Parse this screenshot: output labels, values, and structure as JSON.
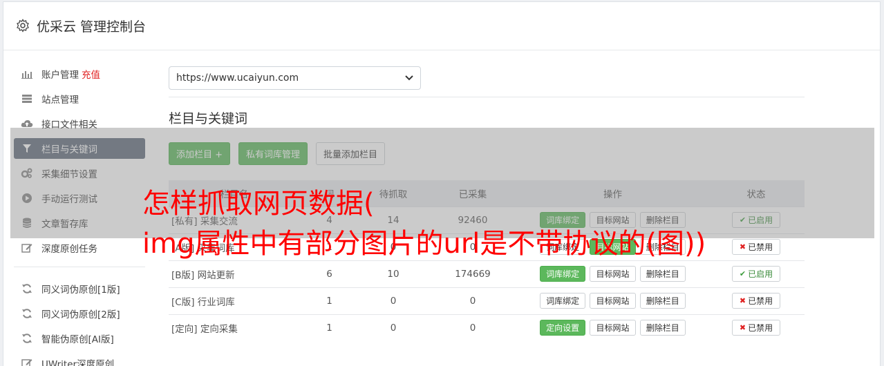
{
  "header": {
    "title": "优采云 管理控制台",
    "icon": "gear-icon"
  },
  "sidebar": {
    "items": [
      {
        "label": "账户管理",
        "extra": "充值",
        "icon": "bar-chart-icon"
      },
      {
        "label": "站点管理",
        "icon": "server-icon"
      },
      {
        "label": "接口文件相关",
        "icon": "cloud-upload-icon"
      },
      {
        "label": "栏目与关键词",
        "icon": "filter-icon",
        "active": true
      },
      {
        "label": "采集细节设置",
        "icon": "cogs-icon"
      },
      {
        "label": "手动运行测试",
        "icon": "play-circle-icon"
      },
      {
        "label": "文章暂存库",
        "icon": "database-icon"
      },
      {
        "label": "深度原创任务",
        "icon": "edit-icon"
      }
    ],
    "items2": [
      {
        "label": "同义词伪原创[1版]",
        "icon": "refresh-icon"
      },
      {
        "label": "同义词伪原创[2版]",
        "icon": "refresh-icon"
      },
      {
        "label": "智能伪原创[AI版]",
        "icon": "refresh-icon"
      },
      {
        "label": "UWriter深度原创",
        "icon": "edit-icon"
      }
    ]
  },
  "main": {
    "site_select": "https://www.ucaiyun.com",
    "section_title": "栏目与关键词",
    "buttons": {
      "add": "添加栏目 +",
      "private_lib": "私有词库管理",
      "batch_add": "批量添加栏目"
    }
  },
  "table": {
    "headers": [
      "栏目名",
      "待抓取",
      "已采集",
      "操作",
      "状态"
    ],
    "header_partial": "词",
    "rows": [
      {
        "tag": "[私有]",
        "name": "采集交流",
        "kw": "4",
        "pending": "14",
        "collected": "92460",
        "bind": "词库绑定",
        "target": "目标网站",
        "del": "删除栏目",
        "status": "已启用",
        "on": true,
        "bind_green": true
      },
      {
        "tag": "[A版]",
        "name": "采集词库",
        "kw": "1",
        "pending": "0",
        "collected": "0",
        "bind": "词库绑定",
        "target": "目标网站",
        "del": "删除栏目",
        "status": "已禁用",
        "on": false,
        "bind_green": false
      },
      {
        "tag": "[B版]",
        "name": "网站更新",
        "kw": "6",
        "pending": "10",
        "collected": "174669",
        "bind": "词库绑定",
        "target": "目标网站",
        "del": "删除栏目",
        "status": "已启用",
        "on": true,
        "bind_green": true
      },
      {
        "tag": "[C版]",
        "name": "行业词库",
        "kw": "1",
        "pending": "0",
        "collected": "0",
        "bind": "词库绑定",
        "target": "目标网站",
        "del": "删除栏目",
        "status": "已禁用",
        "on": false,
        "bind_green": false
      },
      {
        "tag": "[定向]",
        "name": "定向采集",
        "kw": "1",
        "pending": "0",
        "collected": "0",
        "bind": "定向设置",
        "target": "目标网站",
        "del": "删除栏目",
        "status": "已禁用",
        "on": false,
        "bind_green": true
      }
    ]
  },
  "overlay": {
    "line1": "怎样抓取网页数据(",
    "line2": "img属性中有部分图片的url是不带协议的(图))",
    "text_color": "#ff0000"
  }
}
